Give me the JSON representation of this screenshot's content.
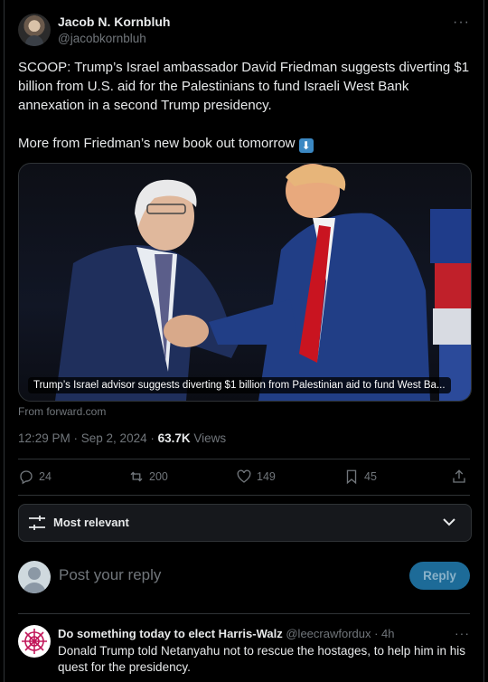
{
  "author": {
    "name": "Jacob N. Kornbluh",
    "handle": "@jacobkornbluh"
  },
  "tweet": {
    "text_p1": "SCOOP: Trump’s Israel ambassador David Friedman suggests diverting $1 billion from U.S. aid for the Palestinians to fund Israeli West Bank annexation in a second Trump presidency.",
    "text_p2": "More from Friedman’s new book out tomorrow",
    "emoji": "down-arrow-emoji"
  },
  "card": {
    "caption": "Trump’s Israel advisor suggests diverting $1 billion from Palestinian aid to fund West Ba...",
    "source": "From forward.com"
  },
  "meta": {
    "time": "12:29 PM · Sep 2, 2024 · ",
    "views_count": "63.7K",
    "views_label": " Views"
  },
  "actions": {
    "replies": "24",
    "reposts": "200",
    "likes": "149",
    "bookmarks": "45"
  },
  "sort": {
    "label": "Most relevant"
  },
  "compose": {
    "placeholder": "Post your reply",
    "button": "Reply"
  },
  "comment": {
    "name": "Do something today to elect Harris-Walz",
    "handle": "@leecrawfordux",
    "time": "4h",
    "text": "Donald Trump told Netanyahu not to rescue the hostages, to help him in his quest for the presidency."
  },
  "colors": {
    "background": "#000000",
    "text": "#e7e9ea",
    "muted": "#71767b",
    "border": "#2f3336",
    "reply_button": "#1d6b98"
  }
}
